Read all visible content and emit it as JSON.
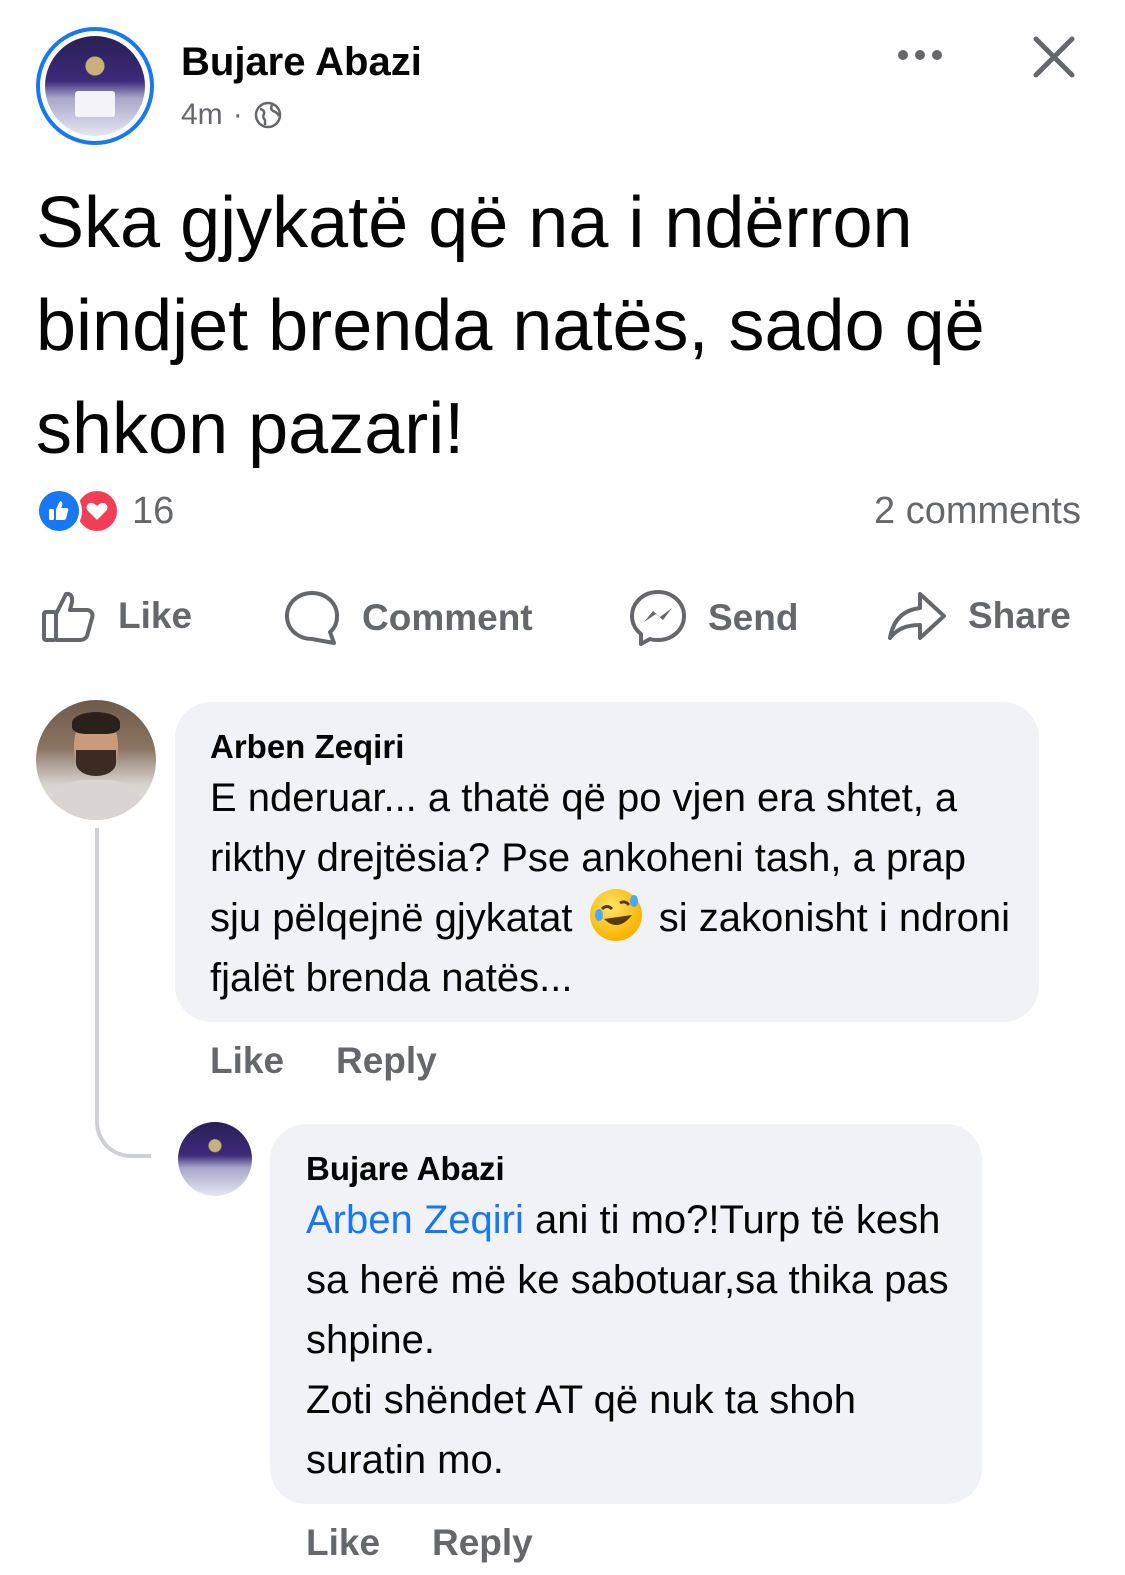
{
  "post": {
    "author": "Bujare Abazi",
    "time": "4m",
    "separator": "·",
    "text": "Ska gjykatë që na i ndërron bindjet brenda natës, sado që shkon pazari!",
    "reaction_count": "16",
    "comments_count": "2 comments",
    "audience_icon": "globe-icon"
  },
  "actions": {
    "like": "Like",
    "comment": "Comment",
    "send": "Send",
    "share": "Share"
  },
  "comments": [
    {
      "author": "Arben Zeqiri",
      "text_before_emoji": "E nderuar... a thatë që po vjen era shtet, a rikthy drejtësia? Pse ankoheni tash, a prap sju pëlqejnë gjykatat",
      "emoji": "rolling-on-floor-laughing-emoji",
      "text_after_emoji": "si zakonisht i ndroni fjalët brenda natës...",
      "like": "Like",
      "reply": "Reply"
    },
    {
      "author": "Bujare Abazi",
      "mention": "Arben Zeqiri",
      "text_line1": " ani ti mo?!Turp të kesh sa herë më ke sabotuar,sa thika pas shpine.",
      "text_line2": "Zoti shëndet AT që nuk ta shoh suratin mo.",
      "like": "Like",
      "reply": "Reply"
    }
  ],
  "colors": {
    "accent": "#1877f2",
    "love": "#f33e58",
    "secondary_text": "#65676b",
    "bubble": "#f0f2f5"
  }
}
